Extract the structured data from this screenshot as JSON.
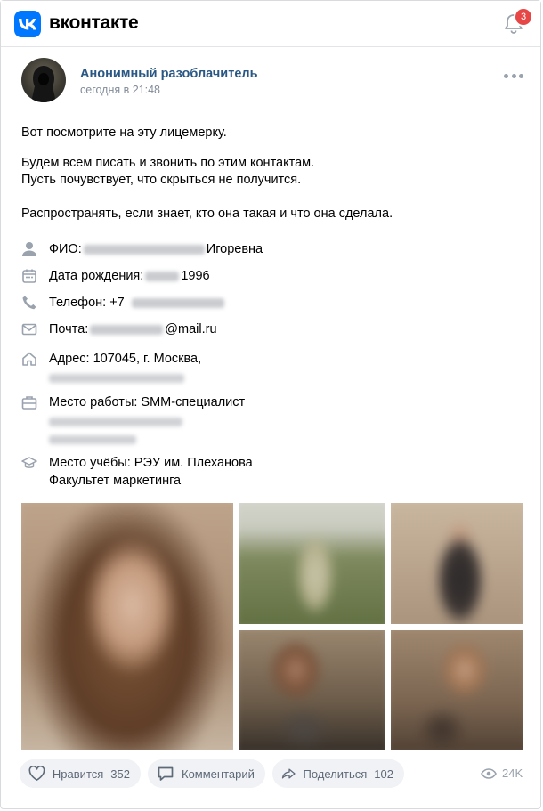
{
  "header": {
    "brand": "вконтакте",
    "notifications_count": "3"
  },
  "post": {
    "author": "Анонимный разоблачитель",
    "time": "сегодня в  21:48",
    "paragraphs": [
      "Вот посмотрите на эту лицемерку.",
      "Будем всем писать и звонить по этим контактам.",
      "Пусть почувствует, что скрыться не получится.",
      "Распространять, если знает, кто она такая и что она сделала."
    ],
    "info": {
      "fio_label": "ФИО:",
      "fio_visible": "Игоревна",
      "birth_label": "Дата рождения:",
      "birth_visible": "1996",
      "phone_label": "Телефон: +7",
      "mail_label": "Почта:",
      "mail_visible": "@mail.ru",
      "address": "Адрес: 107045, г. Москва,",
      "work": "Место работы: SMM-специалист",
      "study": "Место учёбы: РЭУ им. Плеханова",
      "faculty": "Факультет маркетинга"
    },
    "actions": {
      "like_label": "Нравится",
      "like_count": "352",
      "comment_label": "Комментарий",
      "share_label": "Поделиться",
      "share_count": "102",
      "views": "24K"
    }
  },
  "colors": {
    "accent": "#0077ff",
    "author_link": "#2a5885",
    "badge": "#e64646",
    "muted": "#818c99"
  }
}
